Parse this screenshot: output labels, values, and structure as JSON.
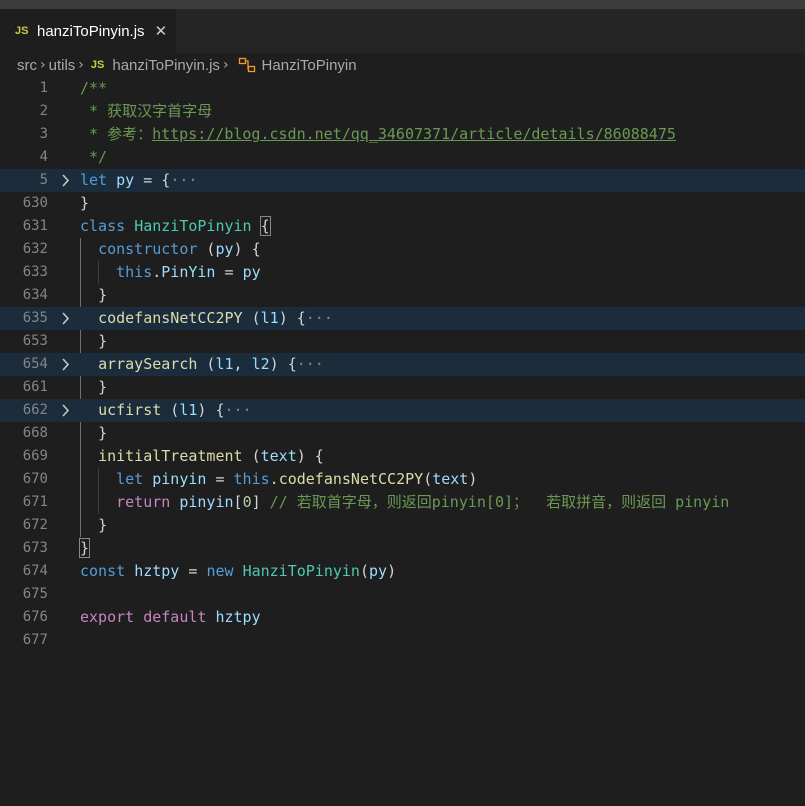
{
  "tab": {
    "icon_text": "JS",
    "title": "hanziToPinyin.js",
    "close_glyph": "✕"
  },
  "breadcrumb": {
    "items": [
      "src",
      "utils",
      "hanziToPinyin.js",
      "HanziToPinyin"
    ],
    "file_icon_text": "JS",
    "separator": "›"
  },
  "gutter": {
    "line_numbers": [
      "1",
      "2",
      "3",
      "4",
      "5",
      "630",
      "631",
      "632",
      "633",
      "634",
      "635",
      "653",
      "654",
      "661",
      "662",
      "668",
      "669",
      "670",
      "671",
      "672",
      "673",
      "674",
      "675",
      "676",
      "677"
    ]
  },
  "code": {
    "l1": {
      "comment": "/**"
    },
    "l2": {
      "comment": " * 获取汉字首字母"
    },
    "l3": {
      "comment_prefix": " * 参考：",
      "link": "https://blog.csdn.net/qq_34607371/article/details/86088475"
    },
    "l4": {
      "comment": " */"
    },
    "l5": {
      "kw": "let",
      "var": "py",
      "rest": " = {",
      "ellipsis": "···"
    },
    "l630": {
      "text": "}"
    },
    "l631": {
      "kw": "class",
      "cls": "HanziToPinyin",
      "brace": "{"
    },
    "l632": {
      "fn": "constructor",
      "p1": " (",
      "var": "py",
      "p2": ") {"
    },
    "l633": {
      "kw": "this",
      "dot": ".",
      "prop": "PinYin",
      "eq": " = ",
      "var": "py"
    },
    "l634": {
      "text": "}"
    },
    "l635": {
      "fn": "codefansNetCC2PY",
      "p1": " (",
      "var": "l1",
      "p2": ") {",
      "ellipsis": "···"
    },
    "l653": {
      "text": "}"
    },
    "l654": {
      "fn": "arraySearch",
      "p1": " (",
      "var1": "l1",
      "comma": ", ",
      "var2": "l2",
      "p2": ") {",
      "ellipsis": "···"
    },
    "l661": {
      "text": "}"
    },
    "l662": {
      "fn": "ucfirst",
      "p1": " (",
      "var": "l1",
      "p2": ") {",
      "ellipsis": "···"
    },
    "l668": {
      "text": "}"
    },
    "l669": {
      "fn": "initialTreatment",
      "p1": " (",
      "var": "text",
      "p2": ") {"
    },
    "l670": {
      "kw": "let",
      "var": "pinyin",
      "eq": " = ",
      "kw2": "this",
      "dot": ".",
      "fn": "codefansNetCC2PY",
      "p1": "(",
      "var2": "text",
      "p2": ")"
    },
    "l671": {
      "ctl": "return",
      "var": "pinyin",
      "idx1": "[",
      "num": "0",
      "idx2": "]",
      "comment": " // 若取首字母，则返回pinyin[0]；  若取拼音，则返回 pinyin"
    },
    "l672": {
      "text": "}"
    },
    "l673": {
      "text": "}"
    },
    "l674": {
      "kw": "const",
      "var": "hztpy",
      "eq": " = ",
      "kw2": "new",
      "cls": "HanziToPinyin",
      "p1": "(",
      "var2": "py",
      "p2": ")"
    },
    "l676": {
      "ctl1": "export",
      "ctl2": "default",
      "var": "hztpy"
    }
  },
  "colors": {
    "background": "#1e1e1e",
    "folded_line_highlight": "#1b2c3c",
    "comment": "#6a9955",
    "keyword": "#569cd6",
    "control": "#c586c0",
    "variable": "#9cdcfe",
    "class": "#4ec9b0",
    "function": "#dcdcaa"
  }
}
